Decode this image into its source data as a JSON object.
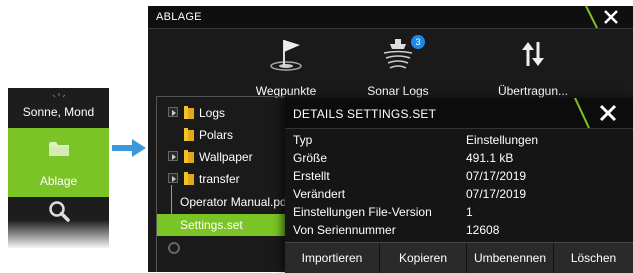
{
  "side_menu": {
    "items": [
      {
        "label": "Sonne, Mond"
      },
      {
        "label": "Ablage"
      }
    ]
  },
  "main": {
    "title": "ABLAGE",
    "tools": [
      {
        "label": "Wegpunkte",
        "icon": "waypoint-flag-icon"
      },
      {
        "label": "Sonar Logs",
        "icon": "sonar-log-icon",
        "badge": "3"
      },
      {
        "label": "Übertragun...",
        "icon": "transfer-arrows-icon"
      }
    ],
    "files": [
      {
        "name": "Logs",
        "type": "folder",
        "expandable": true
      },
      {
        "name": "Polars",
        "type": "folder",
        "expandable": false
      },
      {
        "name": "Wallpaper",
        "type": "folder",
        "expandable": true
      },
      {
        "name": "transfer",
        "type": "folder",
        "expandable": true
      },
      {
        "name": "Operator Manual.pdf",
        "type": "file"
      },
      {
        "name": "Settings.set",
        "type": "file",
        "selected": true
      }
    ]
  },
  "details": {
    "title": "DETAILS SETTINGS.SET",
    "rows": [
      {
        "label": "Typ",
        "value": "Einstellungen"
      },
      {
        "label": "Größe",
        "value": "491.1 kB"
      },
      {
        "label": "Erstellt",
        "value": "07/17/2019"
      },
      {
        "label": "Verändert",
        "value": "07/17/2019"
      },
      {
        "label": "Einstellungen File-Version",
        "value": "1"
      },
      {
        "label": "Von Seriennummer",
        "value": "12608"
      }
    ],
    "buttons": {
      "import": "Importieren",
      "copy": "Kopieren",
      "rename": "Umbenennen",
      "delete": "Löschen"
    }
  },
  "colors": {
    "accent": "#7bc425",
    "arrow": "#3a9ad9",
    "badge": "#1e88e5"
  }
}
